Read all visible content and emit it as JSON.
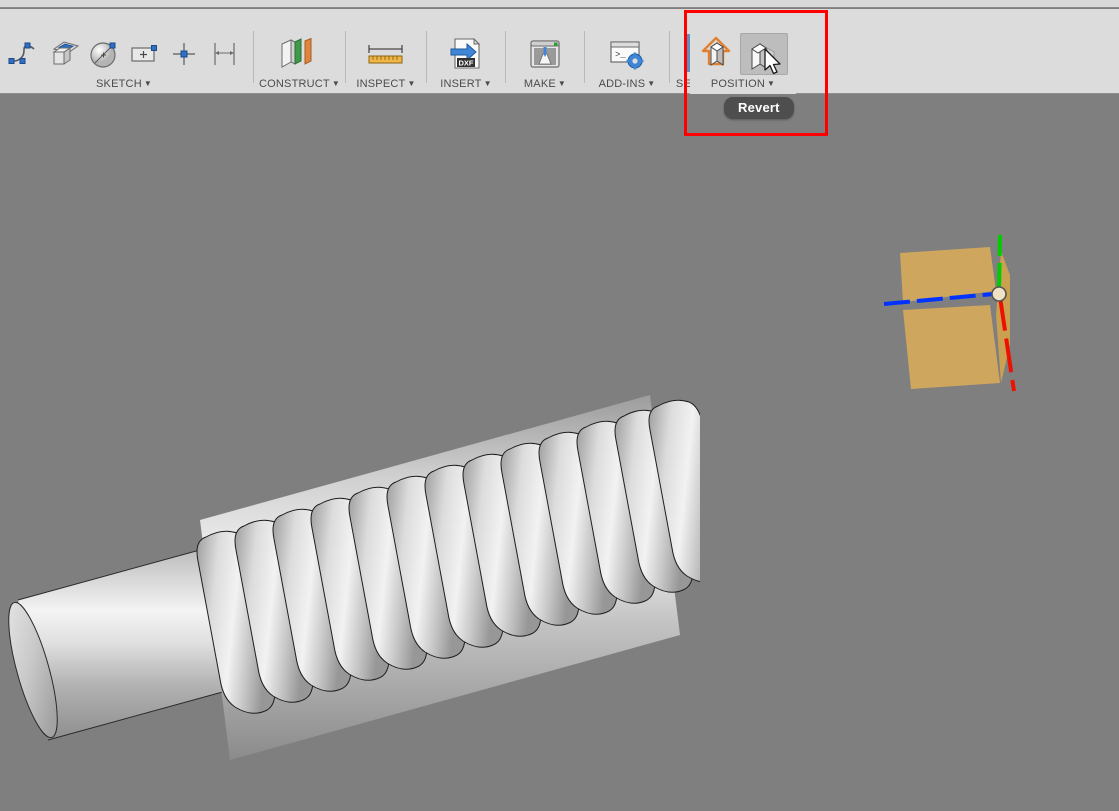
{
  "app": {
    "background_color": "#7f7f7f",
    "toolbar_color": "#dcdcdc",
    "highlight_color": "#ff0000"
  },
  "toolbar": {
    "panels": [
      {
        "label": "SKETCH",
        "has_dropdown": true,
        "tools": [
          {
            "name": "spline-icon",
            "title": "Spline"
          },
          {
            "name": "create-sketch-icon",
            "title": "Create Sketch"
          },
          {
            "name": "circle-icon",
            "title": "Circle"
          },
          {
            "name": "rectangle-icon",
            "title": "Rectangle"
          },
          {
            "name": "point-icon",
            "title": "Point"
          },
          {
            "name": "sketch-dimension-icon",
            "title": "Sketch Dimension"
          }
        ]
      },
      {
        "label": "CONSTRUCT",
        "has_dropdown": true,
        "tools": [
          {
            "name": "offset-plane-icon",
            "title": "Offset Plane"
          }
        ]
      },
      {
        "label": "INSPECT",
        "has_dropdown": true,
        "tools": [
          {
            "name": "measure-ruler-icon",
            "title": "Measure"
          }
        ]
      },
      {
        "label": "INSERT",
        "has_dropdown": true,
        "tools": [
          {
            "name": "insert-dxf-icon",
            "title": "Insert DXF"
          }
        ]
      },
      {
        "label": "MAKE",
        "has_dropdown": true,
        "tools": [
          {
            "name": "3d-print-icon",
            "title": "3D Print"
          }
        ]
      },
      {
        "label": "ADD-INS",
        "has_dropdown": true,
        "tools": [
          {
            "name": "scripts-and-addins-icon",
            "title": "Scripts and Add-Ins"
          }
        ]
      },
      {
        "label": "SELECT",
        "has_dropdown": true,
        "tools": [
          {
            "name": "window-select-icon",
            "title": "Select"
          }
        ]
      }
    ],
    "position_panel": {
      "label": "POSITION",
      "has_dropdown": true,
      "tools": [
        {
          "name": "move-copy-icon",
          "title": "Move/Copy",
          "hovered": false
        },
        {
          "name": "revert-icon",
          "title": "Revert",
          "hovered": true
        }
      ]
    }
  },
  "tooltip": {
    "text": "Revert"
  },
  "viewport": {
    "model": {
      "name": "worm-gear-shaft",
      "thread_count": 13
    },
    "origin_indicator": {
      "x_axis_color": "#0033ff",
      "y_axis_color": "#00cc00",
      "z_axis_color": "#ee1100",
      "plane_color": "#d4a95c"
    }
  }
}
